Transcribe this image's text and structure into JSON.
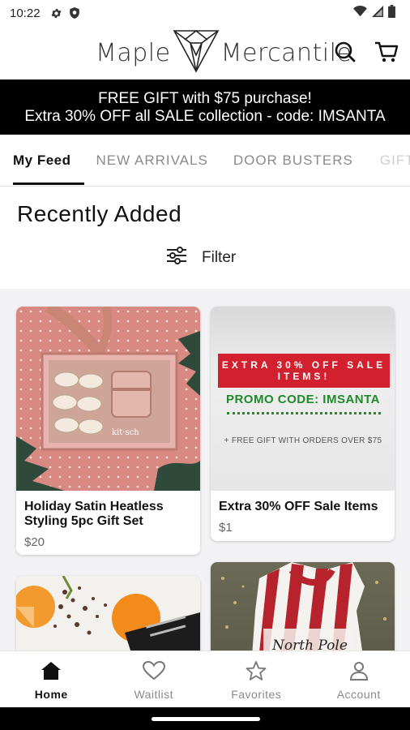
{
  "status_bar": {
    "time": "10:22",
    "icons_left": [
      "gear-icon",
      "shield-icon"
    ],
    "icons_right": [
      "wifi-icon",
      "signal-icon",
      "battery-icon"
    ]
  },
  "header": {
    "logo_left": "Maple",
    "logo_right": "Mercantile",
    "icons": [
      "search-icon",
      "cart-icon"
    ]
  },
  "banner": {
    "line1": "FREE GIFT with $75 purchase!",
    "line2": "Extra 30% OFF all SALE collection - code: IMSANTA"
  },
  "tabs": [
    {
      "label": "My Feed",
      "active": true
    },
    {
      "label": "NEW ARRIVALS",
      "active": false
    },
    {
      "label": "DOOR BUSTERS",
      "active": false
    },
    {
      "label": "GIFT",
      "active": false
    }
  ],
  "section": {
    "title": "Recently Added",
    "filter_label": "Filter"
  },
  "products": [
    {
      "name": "Holiday Satin Heatless Styling 5pc Gift Set",
      "price": "$20",
      "image": "gift-box-image"
    },
    {
      "name": "Extra 30% OFF Sale Items",
      "price": "$1",
      "image": "promo-image"
    },
    {
      "name": "",
      "price": "",
      "image": "tea-oranges-image"
    },
    {
      "name": "",
      "price": "",
      "image": "santa-sack-image"
    }
  ],
  "promo_image": {
    "red_text": "EXTRA 30% OFF SALE ITEMS!",
    "code_text": "PROMO CODE: IMSANTA",
    "sub_text": "+ FREE GIFT WITH ORDERS OVER $75"
  },
  "sack_text": "North Pole",
  "bottom_nav": [
    {
      "label": "Home",
      "icon": "home-icon",
      "active": true
    },
    {
      "label": "Waitlist",
      "icon": "heart-icon",
      "active": false
    },
    {
      "label": "Favorites",
      "icon": "star-icon",
      "active": false
    },
    {
      "label": "Account",
      "icon": "person-icon",
      "active": false
    }
  ],
  "colors": {
    "banner_bg": "#000000",
    "accent_red": "#d3202e",
    "promo_green": "#1f8a2b",
    "grid_bg": "#f2f2f4"
  }
}
